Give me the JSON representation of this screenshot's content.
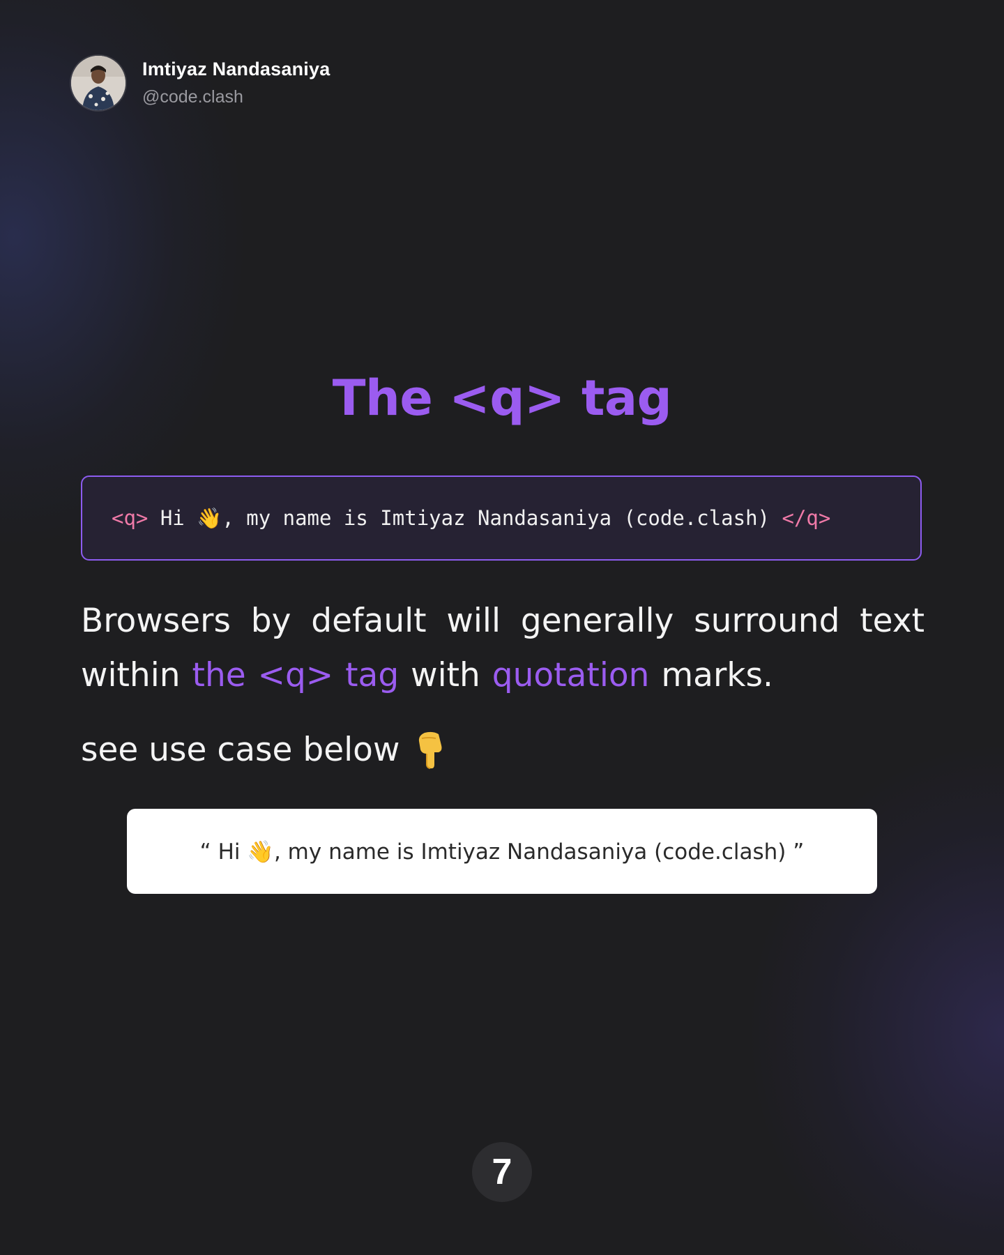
{
  "author": {
    "name": "Imtiyaz Nandasaniya",
    "handle": "@code.clash"
  },
  "title": "The <q> tag",
  "code": {
    "open_tag": "<q>",
    "content": " Hi 👋, my name is Imtiyaz Nandasaniya (code.clash) ",
    "close_tag": "</q>"
  },
  "description": {
    "part1": "Browsers by default will generally surround text within ",
    "highlight1": "the <q> tag",
    "part2": " with ",
    "highlight2": "quotation",
    "part3": " marks."
  },
  "use_case": {
    "label": "see use case below",
    "icon": "pointing-down-hand-icon"
  },
  "output": {
    "text": "“ Hi 👋, my name is Imtiyaz Nandasaniya (code.clash) ”"
  },
  "page_number": "7",
  "colors": {
    "accent": "#9b5cf0",
    "tag": "#f07aa8",
    "background": "#1e1e20"
  }
}
